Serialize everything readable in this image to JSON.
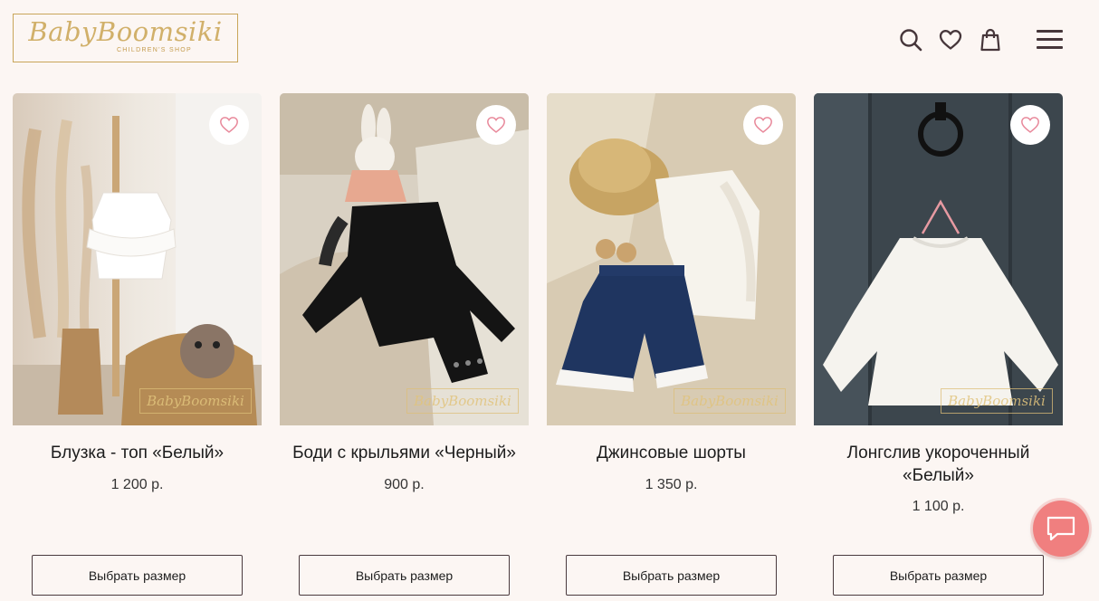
{
  "header": {
    "logo_text": "BabyBoomsiki",
    "logo_subtitle": "CHILDREN'S SHOP",
    "icons": [
      "search-icon",
      "heart-icon",
      "bag-icon",
      "menu-icon"
    ]
  },
  "products": [
    {
      "title": "Блузка - топ «Белый»",
      "price": "1 200 р.",
      "button": "Выбрать размер",
      "watermark": "BabyBoomsiki"
    },
    {
      "title": "Боди с крыльями «Черный»",
      "price": "900 р.",
      "button": "Выбрать размер",
      "watermark": "BabyBoomsiki"
    },
    {
      "title": "Джинсовые шорты",
      "price": "1 350 р.",
      "button": "Выбрать размер",
      "watermark": "BabyBoomsiki"
    },
    {
      "title": "Лонгслив укороченный «Белый»",
      "price": "1 100 р.",
      "button": "Выбрать размер",
      "watermark": "BabyBoomsiki"
    }
  ],
  "colors": {
    "background": "#fcf6f3",
    "accent_gold": "#c9a65a",
    "heart_pink": "#e8889a",
    "chat_coral": "#f07f7f"
  },
  "chat_widget": {
    "icon": "chat-bubble-icon"
  }
}
